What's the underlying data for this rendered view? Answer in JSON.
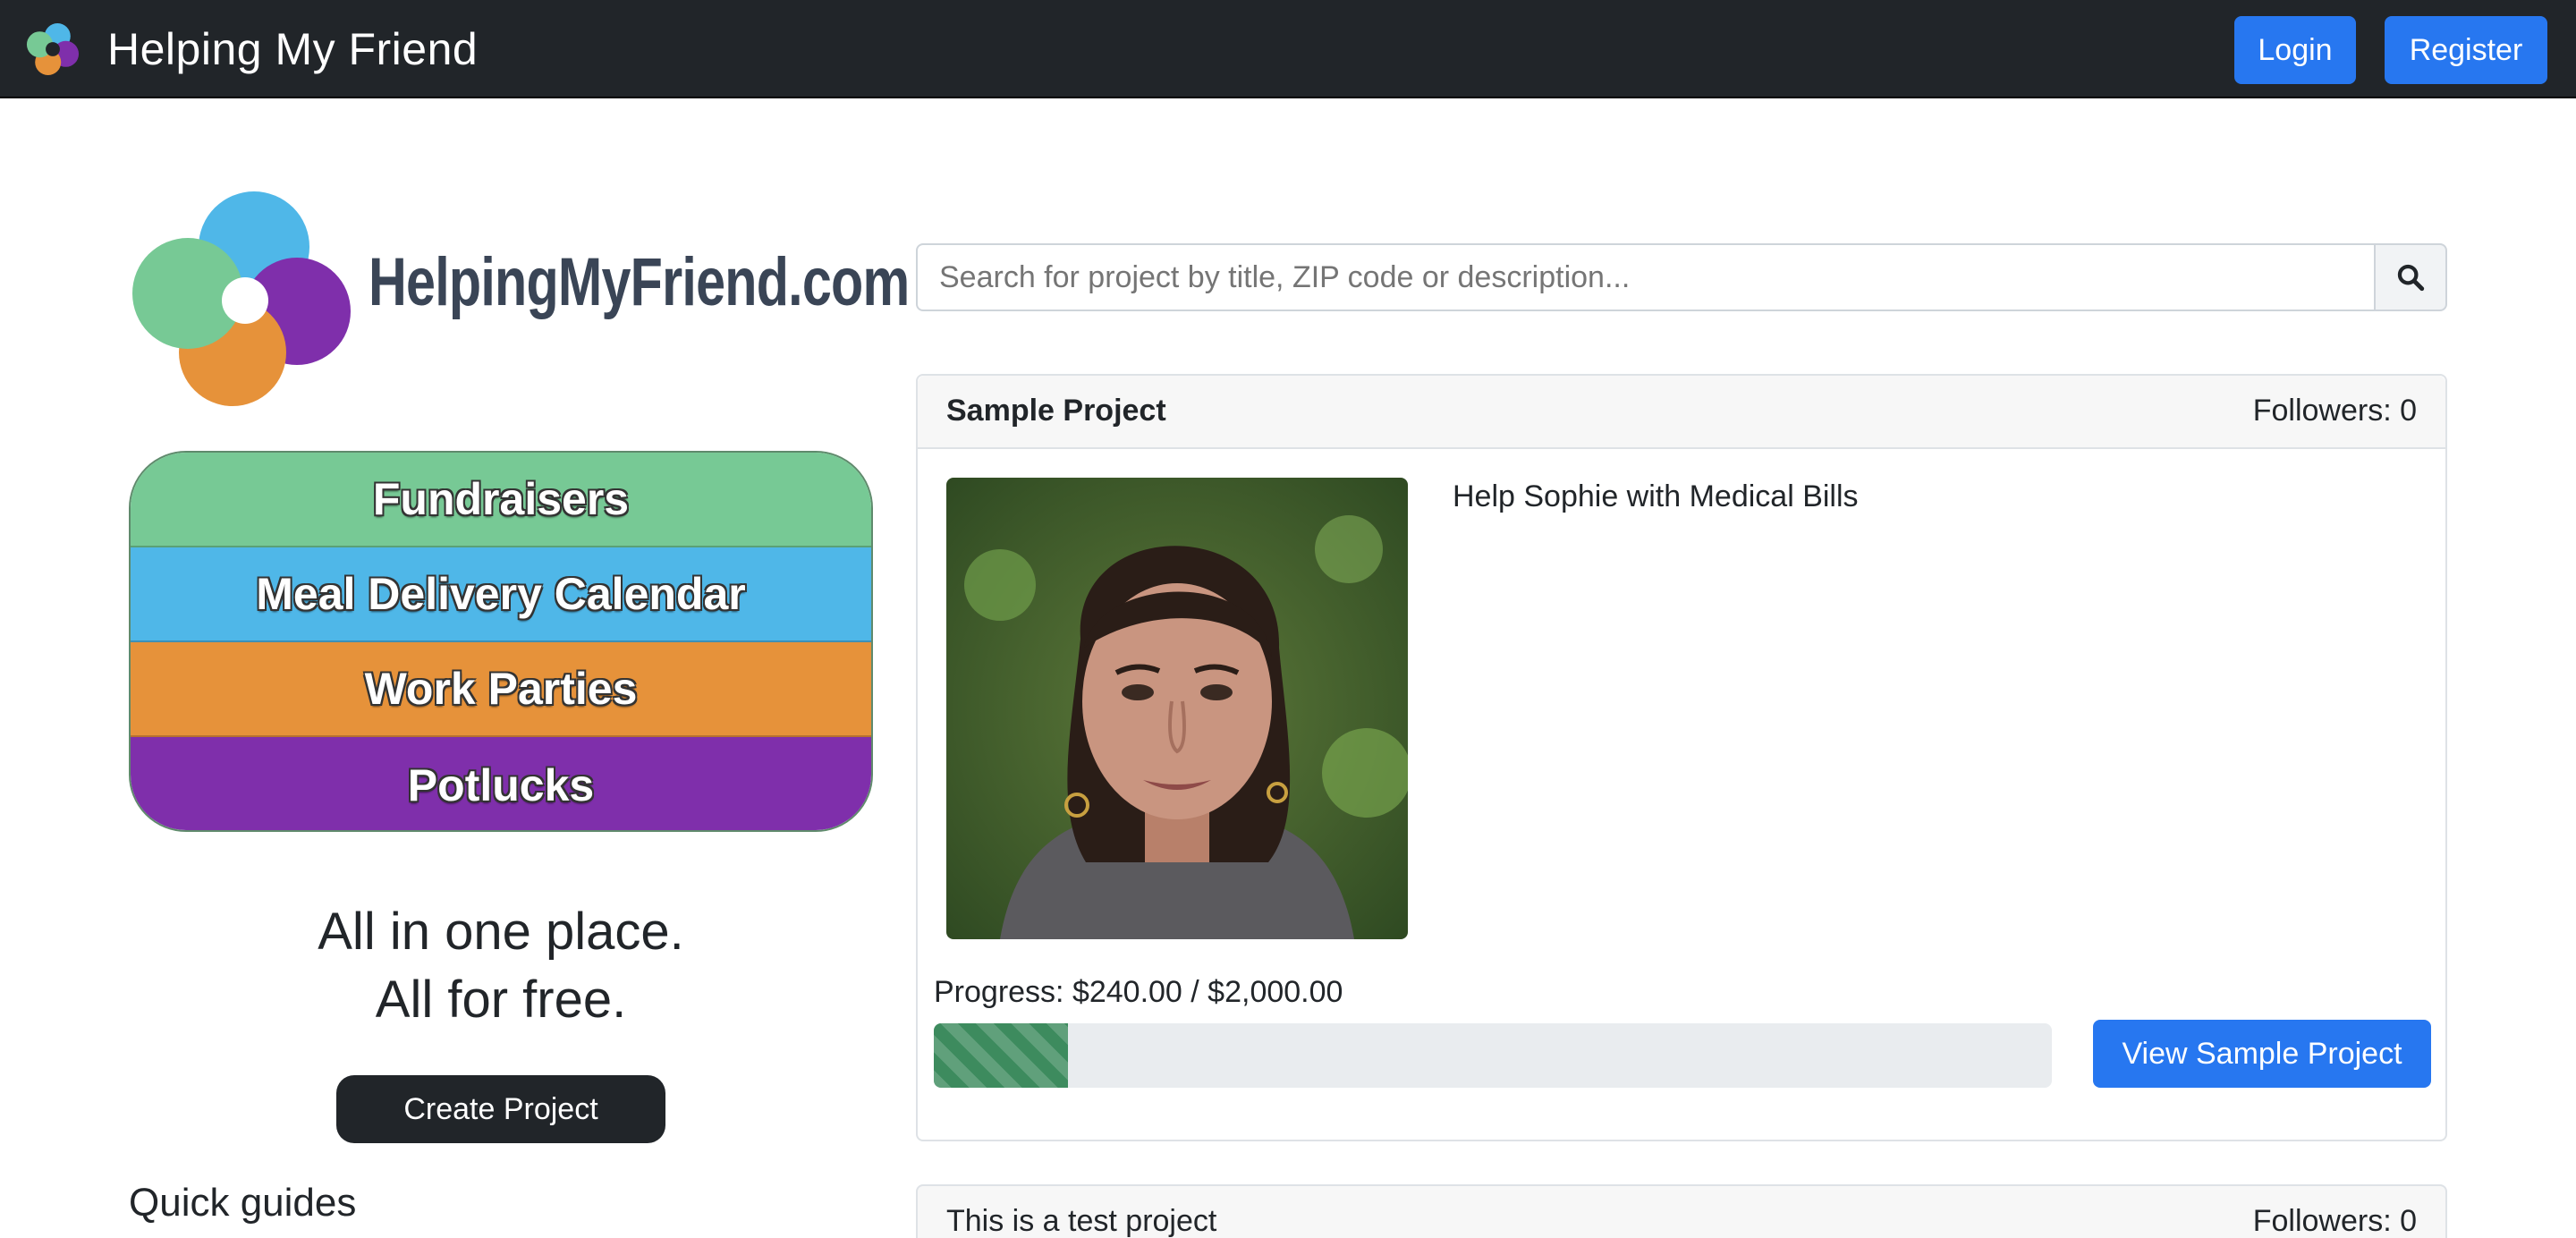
{
  "navbar": {
    "brand": "Helping My Friend",
    "login_label": "Login",
    "register_label": "Register"
  },
  "logo": {
    "text": "HelpingMyFriend.com",
    "colors": [
      "#4fb7e8",
      "#7f2fab",
      "#e6923a",
      "#77c995"
    ]
  },
  "categories": [
    {
      "label": "Fundraisers",
      "color": "#77c995"
    },
    {
      "label": "Meal Delivery Calendar",
      "color": "#4fb7e8"
    },
    {
      "label": "Work Parties",
      "color": "#e6923a"
    },
    {
      "label": "Potlucks",
      "color": "#7f2fab"
    }
  ],
  "tagline": {
    "line1": "All in one place.",
    "line2": "All for free."
  },
  "create_project_label": "Create Project",
  "quick_guides_label": "Quick guides",
  "search": {
    "placeholder": "Search for project by title, ZIP code or description...",
    "icon": "search-icon"
  },
  "projects": [
    {
      "title": "Sample Project",
      "followers": "Followers: 0",
      "description": "Help Sophie with Medical Bills",
      "progress_label": "Progress: $240.00 / $2,000.00",
      "progress_fraction": 0.12,
      "button_label": "View Sample Project"
    },
    {
      "title": "This is a test project",
      "followers": "Followers: 0"
    }
  ],
  "colors": {
    "navbar": "#212529",
    "primary": "#2777f0",
    "progress": "#3d8b5e"
  }
}
